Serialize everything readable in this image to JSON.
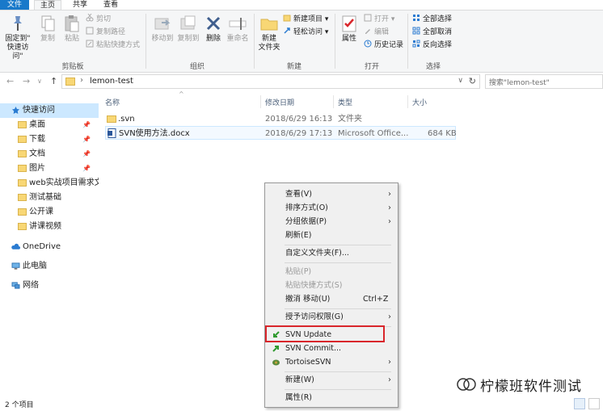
{
  "ribbon_tabs": [
    "文件",
    "主页",
    "共享",
    "查看"
  ],
  "clipboard": {
    "pin_label_1": "固定到\"",
    "pin_label_2": "快速访问\"",
    "copy": "复制",
    "paste": "粘贴",
    "cut": "剪切",
    "copy_path": "复制路径",
    "paste_shortcut": "粘贴快捷方式",
    "group": "剪贴板"
  },
  "organize": {
    "move_to": "移动到",
    "copy_to": "复制到",
    "delete": "删除",
    "rename": "重命名",
    "group": "组织"
  },
  "new_group": {
    "new_folder_1": "新建",
    "new_folder_2": "文件夹",
    "new_item": "新建项目 ▾",
    "easy_access": "轻松访问 ▾",
    "group": "新建"
  },
  "open_group": {
    "properties": "属性",
    "open": "打开 ▾",
    "edit": "编辑",
    "history": "历史记录",
    "group": "打开"
  },
  "select_group": {
    "select_all": "全部选择",
    "select_none": "全部取消",
    "invert": "反向选择",
    "group": "选择"
  },
  "address": {
    "path": "lemon-test",
    "search_placeholder": "搜索\"lemon-test\""
  },
  "nav": {
    "quick_access": "快速访问",
    "items": [
      "桌面",
      "下载",
      "文档",
      "图片",
      "web实战项目需求文",
      "测试基础",
      "公开课",
      "讲课视频"
    ],
    "onedrive": "OneDrive",
    "this_pc": "此电脑",
    "network": "网络"
  },
  "columns": [
    "名称",
    "修改日期",
    "类型",
    "大小"
  ],
  "files": [
    {
      "name": ".svn",
      "date": "2018/6/29 16:13",
      "type": "文件夹",
      "size": ""
    },
    {
      "name": "SVN使用方法.docx",
      "date": "2018/6/29 17:13",
      "type": "Microsoft Office...",
      "size": "684 KB"
    }
  ],
  "status": {
    "count": "2 个项目"
  },
  "context_menu": {
    "view": "查看(V)",
    "sort": "排序方式(O)",
    "group_by": "分组依据(P)",
    "refresh": "刷新(E)",
    "customize": "自定义文件夹(F)...",
    "paste": "粘贴(P)",
    "paste_shortcut": "粘贴快捷方式(S)",
    "undo": "撤消 移动(U)",
    "undo_shortcut": "Ctrl+Z",
    "grant_access": "授予访问权限(G)",
    "svn_update": "SVN Update",
    "svn_commit": "SVN Commit...",
    "tortoise": "TortoiseSVN",
    "new": "新建(W)",
    "properties": "属性(R)"
  },
  "watermark": "柠檬班软件测试",
  "colors": {
    "accent": "#1979ca",
    "highlight_box": "#d9262b",
    "selection": "#cce8ff"
  }
}
